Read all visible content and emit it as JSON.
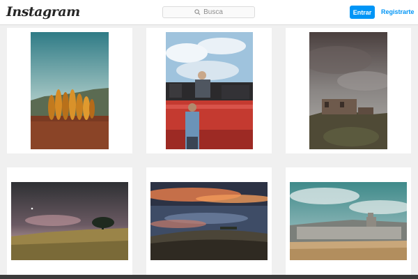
{
  "header": {
    "logo": "Instagram",
    "search": {
      "placeholder": "Busca"
    },
    "login_label": "Entrar",
    "signup_label": "Registrarte"
  },
  "posts": [
    {
      "name": "autumn-poplar-trees-photo"
    },
    {
      "name": "farmer-on-red-truck-photo"
    },
    {
      "name": "stone-ruin-hilltop-photo"
    },
    {
      "name": "lone-tree-dusk-photo"
    },
    {
      "name": "sunset-fields-photo"
    },
    {
      "name": "hilltop-village-photo"
    }
  ],
  "colors": {
    "accent": "#0095f6",
    "background": "#f0f0f0",
    "card": "#ffffff"
  }
}
